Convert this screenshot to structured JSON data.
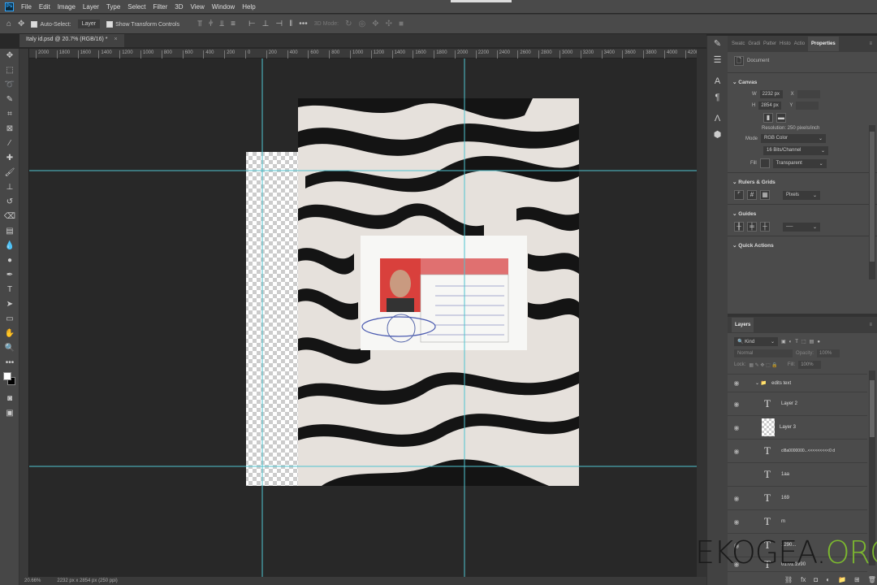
{
  "menu": {
    "items": [
      "File",
      "Edit",
      "Image",
      "Layer",
      "Type",
      "Select",
      "Filter",
      "3D",
      "View",
      "Window",
      "Help"
    ]
  },
  "options": {
    "auto_select_label": "Auto-Select:",
    "auto_select_target": "Layer",
    "show_transform_label": "Show Transform Controls",
    "mode_3d": "3D Mode:"
  },
  "document_tab": {
    "title": "Italy id.psd @ 20.7% (RGB/16) *",
    "close": "×"
  },
  "ruler": {
    "labels": [
      "2000",
      "1800",
      "1600",
      "1400",
      "1200",
      "1000",
      "800",
      "600",
      "400",
      "200",
      "0",
      "200",
      "400",
      "600",
      "800",
      "1000",
      "1200",
      "1400",
      "1600",
      "1800",
      "2000",
      "2200",
      "2400",
      "2600",
      "2800",
      "3000",
      "3200",
      "3400",
      "3600",
      "3800",
      "4000",
      "4200"
    ]
  },
  "status": {
    "zoom": "20.66%",
    "doc_info": "2232 px x 2854 px (250 ppi)"
  },
  "panel_tabs": [
    "Swatc",
    "Gradi",
    "Patter",
    "Histo",
    "Actio",
    "Properties"
  ],
  "properties": {
    "type": "Document",
    "canvas_title": "Canvas",
    "w_label": "W",
    "w": "2232 px",
    "h_label": "H",
    "h": "2854 px",
    "x_label": "X",
    "y_label": "Y",
    "resolution": "Resolution: 250 pixels/inch",
    "mode_label": "Mode",
    "mode": "RGB Color",
    "depth": "16 Bits/Channel",
    "fill_label": "Fill",
    "fill": "Transparent",
    "rulers_title": "Rulers & Grids",
    "units": "Pixels",
    "guides_title": "Guides",
    "quick_actions_title": "Quick Actions"
  },
  "layers": {
    "title": "Layers",
    "filter": "Kind",
    "blend": "Normal",
    "opacity_label": "Opacity:",
    "opacity": "100%",
    "lock_label": "Lock:",
    "fill_label": "Fill:",
    "fill": "100%",
    "items": [
      {
        "name": "edits text",
        "kind": "group",
        "visible": true
      },
      {
        "name": "Layer 2",
        "kind": "text",
        "visible": true
      },
      {
        "name": "Layer 3",
        "kind": "pixel",
        "visible": true
      },
      {
        "name": "cl8a0000000...<<<<<<<<<0 d",
        "kind": "text",
        "visible": true
      },
      {
        "name": "1aa",
        "kind": "text",
        "visible": false
      },
      {
        "name": "169",
        "kind": "text",
        "visible": true
      },
      {
        "name": "m",
        "kind": "text",
        "visible": true
      },
      {
        "name": "1290...",
        "kind": "text",
        "visible": true
      },
      {
        "name": "01.01.1990",
        "kind": "text",
        "visible": true
      }
    ]
  },
  "watermark": {
    "part1": "EKOGEA.",
    "part2": "ORG"
  },
  "colors": {
    "guide": "#4fc3cf",
    "accent": "#31a8ff",
    "watermark_green": "#7cb82f"
  }
}
